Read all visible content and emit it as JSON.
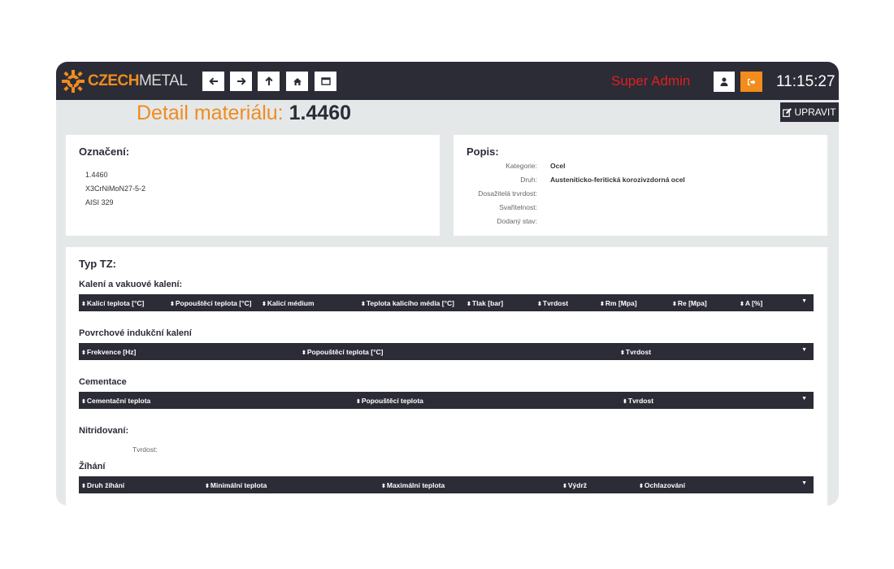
{
  "header": {
    "logo_a": "CZECH",
    "logo_b": "METAL",
    "user_name": "Super Admin",
    "clock": "11:15:27",
    "nav_icons": [
      "arrow-left-icon",
      "arrow-right-icon",
      "arrow-up-icon",
      "home-icon",
      "window-icon"
    ]
  },
  "page": {
    "title_label": "Detail materiálu:",
    "title_value": "1.4460",
    "edit_label": "UPRAVIT"
  },
  "oznaceni": {
    "title": "Označení:",
    "codes": [
      "1.4460",
      "X3CrNiMoN27-5-2",
      "AISI 329"
    ]
  },
  "popis": {
    "title": "Popis:",
    "props": [
      {
        "label": "Kategorie:",
        "value": "Ocel"
      },
      {
        "label": "Druh:",
        "value": "Austeniticko-feritická korozivzdorná ocel"
      },
      {
        "label": "Dosažitelá trvrdost:",
        "value": ""
      },
      {
        "label": "Svařitelnost:",
        "value": ""
      },
      {
        "label": "Dodaný stav:",
        "value": ""
      }
    ]
  },
  "typtz": {
    "title": "Typ TZ:",
    "kaleni": {
      "title": "Kalení a vakuové kalení:",
      "columns": [
        "Kalicí teplota [°C]",
        "Popouštěcí teplota [°C]",
        "Kalicí médium",
        "Teplota kalicího média [°C]",
        "Tlak [bar]",
        "Tvrdost",
        "Rm [Mpa]",
        "Re [Mpa]",
        "A [%]"
      ]
    },
    "povrchove": {
      "title": "Povrchové indukční kalení",
      "columns": [
        "Frekvence [Hz]",
        "Popouštěcí teplota [°C]",
        "Tvrdost"
      ]
    },
    "cementace": {
      "title": "Cementace",
      "columns": [
        "Cementační teplota",
        "Popouštěcí teplota",
        "Tvrdost"
      ]
    },
    "nitridovani": {
      "title": "Nitridovaní:",
      "label": "Tvrdost:"
    },
    "zihani": {
      "title": "Žíhání",
      "columns": [
        "Druh žíhání",
        "Minimální teplota",
        "Maximální teplota",
        "Výdrž",
        "Ochlazování"
      ]
    }
  },
  "colors": {
    "accent": "#f08c1e",
    "dark": "#2b2c36",
    "user": "#e0201f"
  }
}
